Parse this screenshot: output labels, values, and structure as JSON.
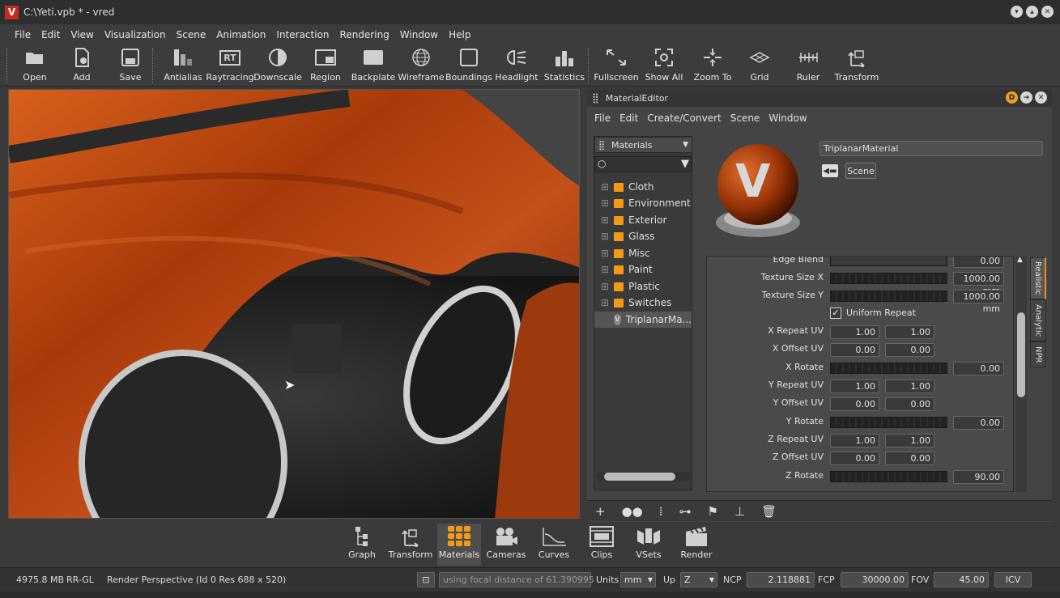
{
  "window": {
    "title": "C:\\Yeti.vpb * - vred",
    "app_logo": "V"
  },
  "menu": [
    "File",
    "Edit",
    "View",
    "Visualization",
    "Scene",
    "Animation",
    "Interaction",
    "Rendering",
    "Window",
    "Help"
  ],
  "toolbar": [
    {
      "label": "Open",
      "icon": "folder-open-icon"
    },
    {
      "label": "Add",
      "icon": "add-file-icon"
    },
    {
      "label": "Save",
      "icon": "save-icon"
    },
    {
      "label": "Antialias",
      "icon": "antialias-icon"
    },
    {
      "label": "Raytracing",
      "icon": "raytracing-icon",
      "glyph": "RT"
    },
    {
      "label": "Downscale",
      "icon": "downscale-icon"
    },
    {
      "label": "Region",
      "icon": "region-icon"
    },
    {
      "label": "Backplate",
      "icon": "backplate-icon"
    },
    {
      "label": "Wireframe",
      "icon": "wireframe-icon"
    },
    {
      "label": "Boundings",
      "icon": "boundings-icon"
    },
    {
      "label": "Headlight",
      "icon": "headlight-icon"
    },
    {
      "label": "Statistics",
      "icon": "statistics-icon"
    },
    {
      "label": "Fullscreen",
      "icon": "fullscreen-icon"
    },
    {
      "label": "Show All",
      "icon": "show-all-icon"
    },
    {
      "label": "Zoom To",
      "icon": "zoom-to-icon"
    },
    {
      "label": "Grid",
      "icon": "grid-icon"
    },
    {
      "label": "Ruler",
      "icon": "ruler-icon"
    },
    {
      "label": "Transform",
      "icon": "transform-icon"
    }
  ],
  "material_editor": {
    "title": "MaterialEditor",
    "title_badge": "D",
    "menu": [
      "File",
      "Edit",
      "Create/Convert",
      "Scene",
      "Window"
    ],
    "tree_combo": "Materials",
    "tree_items": [
      "Cloth",
      "Environment",
      "Exterior",
      "Glass",
      "Misc",
      "Paint",
      "Plastic",
      "Switches"
    ],
    "selected_material": "TriplanarMa...",
    "preview_logo": "V",
    "material_name": "TriplanarMaterial",
    "scene_button": "Scene",
    "props": {
      "edge_blend_label": "Edge Blend",
      "edge_blend_value": "0.00",
      "tex_x_label": "Texture Size X",
      "tex_x_value": "1000.00 mm",
      "tex_y_label": "Texture Size Y",
      "tex_y_value": "1000.00 mm",
      "uniform_label": "Uniform Repeat",
      "uniform_checked": true,
      "x_repeat_label": "X Repeat UV",
      "x_repeat_u": "1.00",
      "x_repeat_v": "1.00",
      "x_offset_label": "X Offset UV",
      "x_offset_u": "0.00",
      "x_offset_v": "0.00",
      "x_rotate_label": "X Rotate",
      "x_rotate_value": "0.00",
      "y_repeat_label": "Y Repeat UV",
      "y_repeat_u": "1.00",
      "y_repeat_v": "1.00",
      "y_offset_label": "Y Offset UV",
      "y_offset_u": "0.00",
      "y_offset_v": "0.00",
      "y_rotate_label": "Y Rotate",
      "y_rotate_value": "0.00",
      "z_repeat_label": "Z Repeat UV",
      "z_repeat_u": "1.00",
      "z_repeat_v": "1.00",
      "z_offset_label": "Z Offset UV",
      "z_offset_u": "0.00",
      "z_offset_v": "0.00",
      "z_rotate_label": "Z Rotate",
      "z_rotate_value": "90.00"
    },
    "side_tabs": [
      "Realistic",
      "Analytic",
      "NPR"
    ]
  },
  "dock": [
    {
      "label": "Graph",
      "icon": "graph-icon"
    },
    {
      "label": "Transform",
      "icon": "transform-dock-icon"
    },
    {
      "label": "Materials",
      "icon": "materials-icon",
      "active": true
    },
    {
      "label": "Cameras",
      "icon": "cameras-icon"
    },
    {
      "label": "Curves",
      "icon": "curves-icon"
    },
    {
      "label": "Clips",
      "icon": "clips-icon"
    },
    {
      "label": "VSets",
      "icon": "vsets-icon"
    },
    {
      "label": "Render",
      "icon": "render-icon"
    }
  ],
  "status": {
    "memory": "4975.8 MB",
    "renderer": "RR-GL",
    "view_info": "Render Perspective (Id 0 Res 688 x 520)",
    "focal_text": "using focal distance of 61.390995",
    "units_label": "Units",
    "units_value": "mm",
    "up_label": "Up",
    "up_value": "Z",
    "ncp_label": "NCP",
    "ncp_value": "2.118881",
    "fcp_label": "FCP",
    "fcp_value": "30000.00",
    "fov_label": "FOV",
    "fov_value": "45.00",
    "icv_label": "ICV"
  },
  "colors": {
    "accent": "#f39a12",
    "wood": "#b8400c",
    "logo_red": "#c82a1e"
  }
}
